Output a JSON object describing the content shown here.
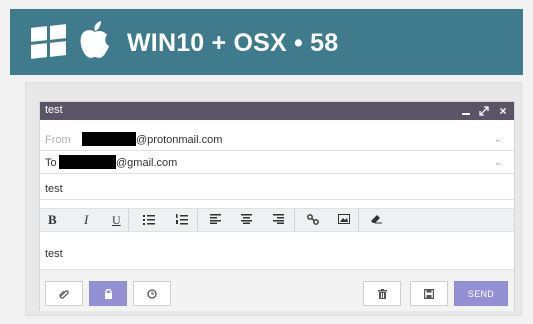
{
  "banner": {
    "title": "WIN10 + OSX • 58",
    "icons": [
      "windows-logo-icon",
      "apple-logo-icon"
    ],
    "background_color": "#3f7b8d"
  },
  "composer": {
    "window_title": "test",
    "window_controls": [
      "minimize-icon",
      "maximize-icon",
      "close-icon"
    ],
    "from": {
      "label": "From",
      "address_suffix": "@protonmail.com"
    },
    "to": {
      "label": "To",
      "address_suffix": "@gmail.com"
    },
    "subject": "test",
    "toolbar": {
      "bold": "B",
      "italic": "I",
      "underline": "U",
      "icons": [
        "unordered-list-icon",
        "ordered-list-icon",
        "align-left-icon",
        "align-center-icon",
        "align-right-icon",
        "link-icon",
        "image-icon",
        "eraser-icon"
      ]
    },
    "body": "test",
    "footer": {
      "icons": [
        "attachment-icon",
        "lock-icon",
        "timer-icon",
        "trash-icon",
        "save-icon"
      ],
      "send_label": "SEND"
    },
    "accent_color": "#9391d4"
  }
}
